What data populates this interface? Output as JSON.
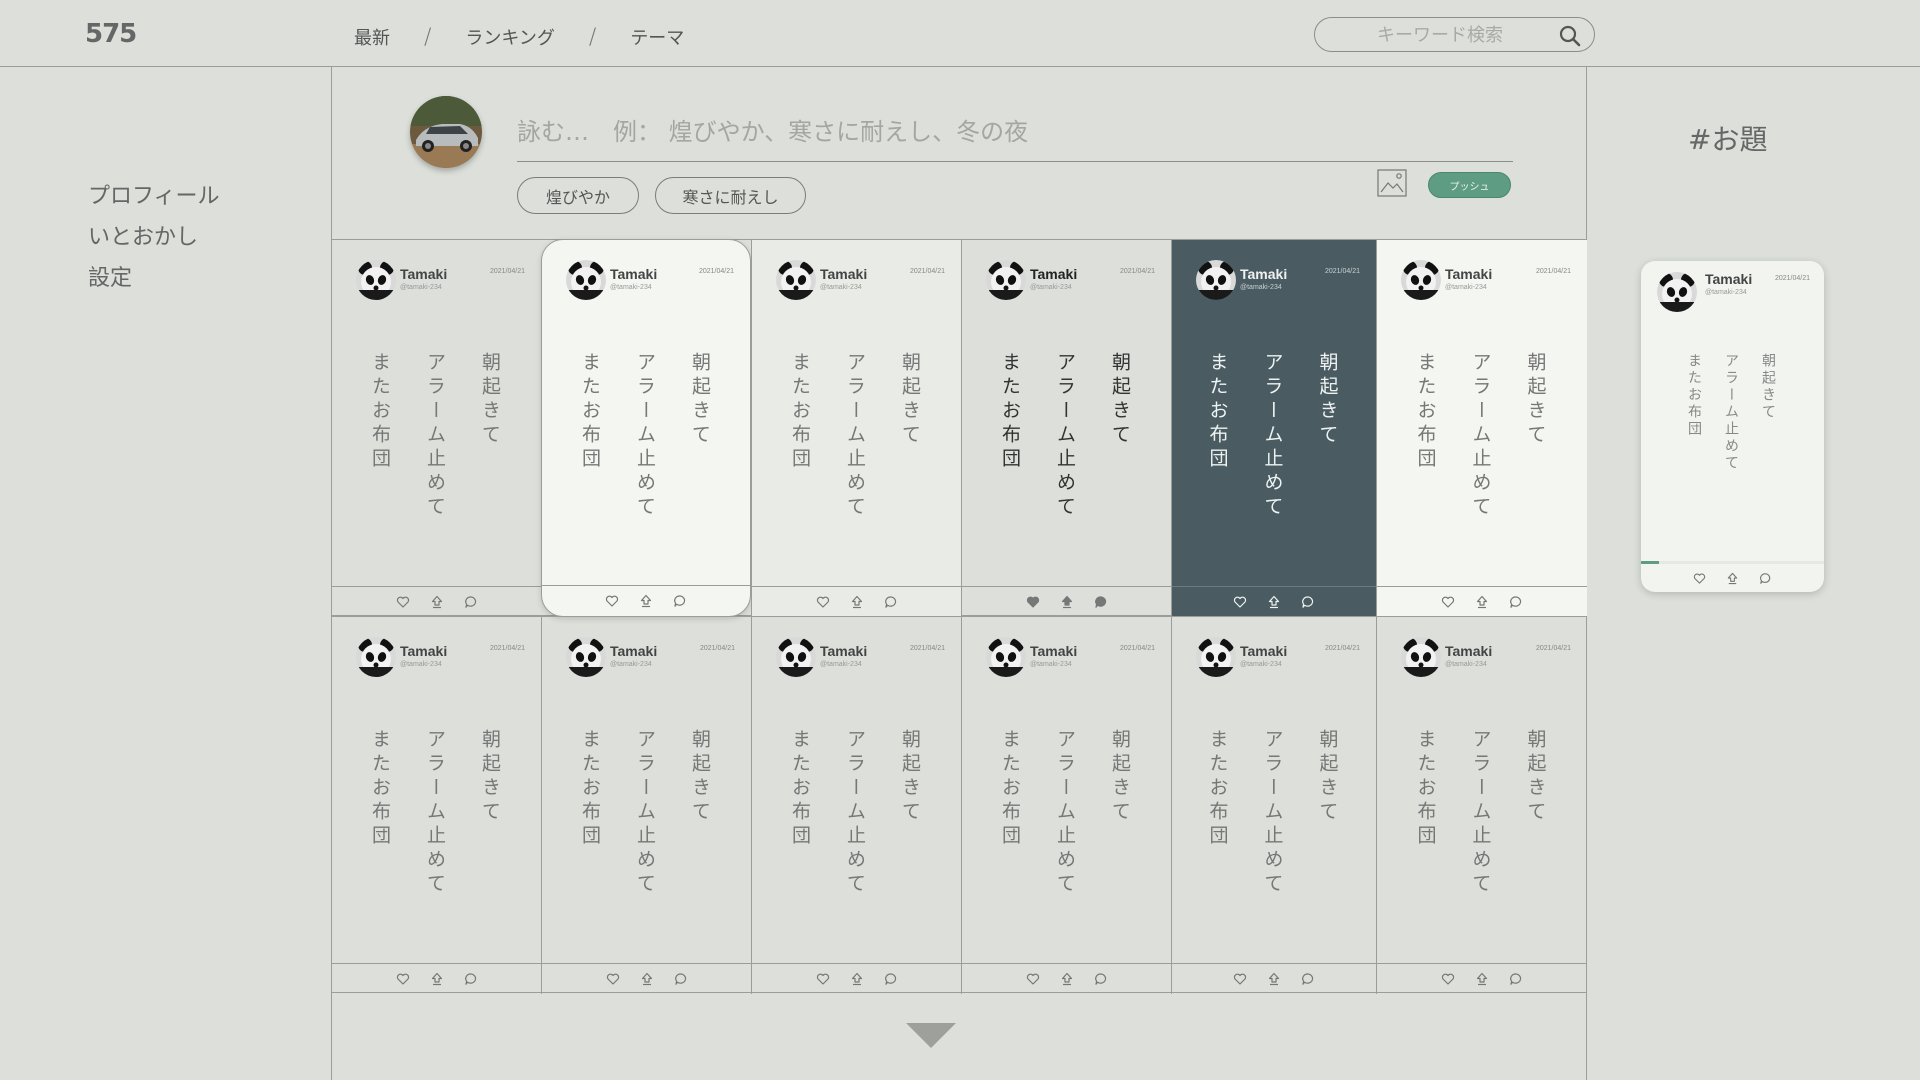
{
  "header": {
    "logo": "575",
    "nav": [
      {
        "label": "最新"
      },
      {
        "label": "ランキング"
      },
      {
        "label": "テーマ"
      }
    ],
    "nav_separator": "/",
    "search_placeholder": "キーワード検索",
    "search_icon": "magnifier-icon"
  },
  "sidebar": {
    "items": [
      {
        "label": "プロフィール"
      },
      {
        "label": "いとおかし"
      },
      {
        "label": "設定"
      }
    ]
  },
  "composer": {
    "placeholder": "詠む…　例： 煌びやか、寒さに耐えし、冬の夜",
    "chips": [
      {
        "label": "煌びやか"
      },
      {
        "label": "寒さに耐えし"
      }
    ],
    "image_icon": "image-icon",
    "push_label": "プッシュ"
  },
  "topic": {
    "title": "#お題"
  },
  "colors": {
    "background": "#dcdfda",
    "accent": "#5f9c84",
    "dark_card": "#4a5c61",
    "light_card": "#f4f6f1"
  },
  "posts": [
    {
      "name": "Tamaki",
      "handle": "@tamaki-234",
      "date": "2021/04/21",
      "lines": [
        "朝起きて",
        "アラーム止めて",
        "またお布団"
      ],
      "style": "default"
    },
    {
      "name": "Tamaki",
      "handle": "@tamaki-234",
      "date": "2021/04/21",
      "lines": [
        "朝起きて",
        "アラーム止めて",
        "またお布団"
      ],
      "style": "lifted"
    },
    {
      "name": "Tamaki",
      "handle": "@tamaki-234",
      "date": "2021/04/21",
      "lines": [
        "朝起きて",
        "アラーム止めて",
        "またお布団"
      ],
      "style": "light"
    },
    {
      "name": "Tamaki",
      "handle": "@tamaki-234",
      "date": "2021/04/21",
      "lines": [
        "朝起きて",
        "アラーム止めて",
        "またお布団"
      ],
      "style": "bold"
    },
    {
      "name": "Tamaki",
      "handle": "@tamaki-234",
      "date": "2021/04/21",
      "lines": [
        "朝起きて",
        "アラーム止めて",
        "またお布団"
      ],
      "style": "dark"
    },
    {
      "name": "Tamaki",
      "handle": "@tamaki-234",
      "date": "2021/04/21",
      "lines": [
        "朝起きて",
        "アラーム止めて",
        "またお布団"
      ],
      "style": "white"
    },
    {
      "name": "Tamaki",
      "handle": "@tamaki-234",
      "date": "2021/04/21",
      "lines": [
        "朝起きて",
        "アラーム止めて",
        "またお布団"
      ],
      "style": "default"
    },
    {
      "name": "Tamaki",
      "handle": "@tamaki-234",
      "date": "2021/04/21",
      "lines": [
        "朝起きて",
        "アラーム止めて",
        "またお布団"
      ],
      "style": "default"
    },
    {
      "name": "Tamaki",
      "handle": "@tamaki-234",
      "date": "2021/04/21",
      "lines": [
        "朝起きて",
        "アラーム止めて",
        "またお布団"
      ],
      "style": "default"
    },
    {
      "name": "Tamaki",
      "handle": "@tamaki-234",
      "date": "2021/04/21",
      "lines": [
        "朝起きて",
        "アラーム止めて",
        "またお布団"
      ],
      "style": "default"
    },
    {
      "name": "Tamaki",
      "handle": "@tamaki-234",
      "date": "2021/04/21",
      "lines": [
        "朝起きて",
        "アラーム止めて",
        "またお布団"
      ],
      "style": "default"
    },
    {
      "name": "Tamaki",
      "handle": "@tamaki-234",
      "date": "2021/04/21",
      "lines": [
        "朝起きて",
        "アラーム止めて",
        "またお布団"
      ],
      "style": "default"
    }
  ],
  "preview": {
    "name": "Tamaki",
    "handle": "@tamaki-234",
    "date": "2021/04/21",
    "lines": [
      "朝起きて",
      "アラーム止めて",
      "またお布団"
    ],
    "progress": 0.1
  },
  "actions": [
    "heart-icon",
    "share-icon",
    "comment-icon"
  ],
  "load_more_icon": "triangle-down-icon"
}
